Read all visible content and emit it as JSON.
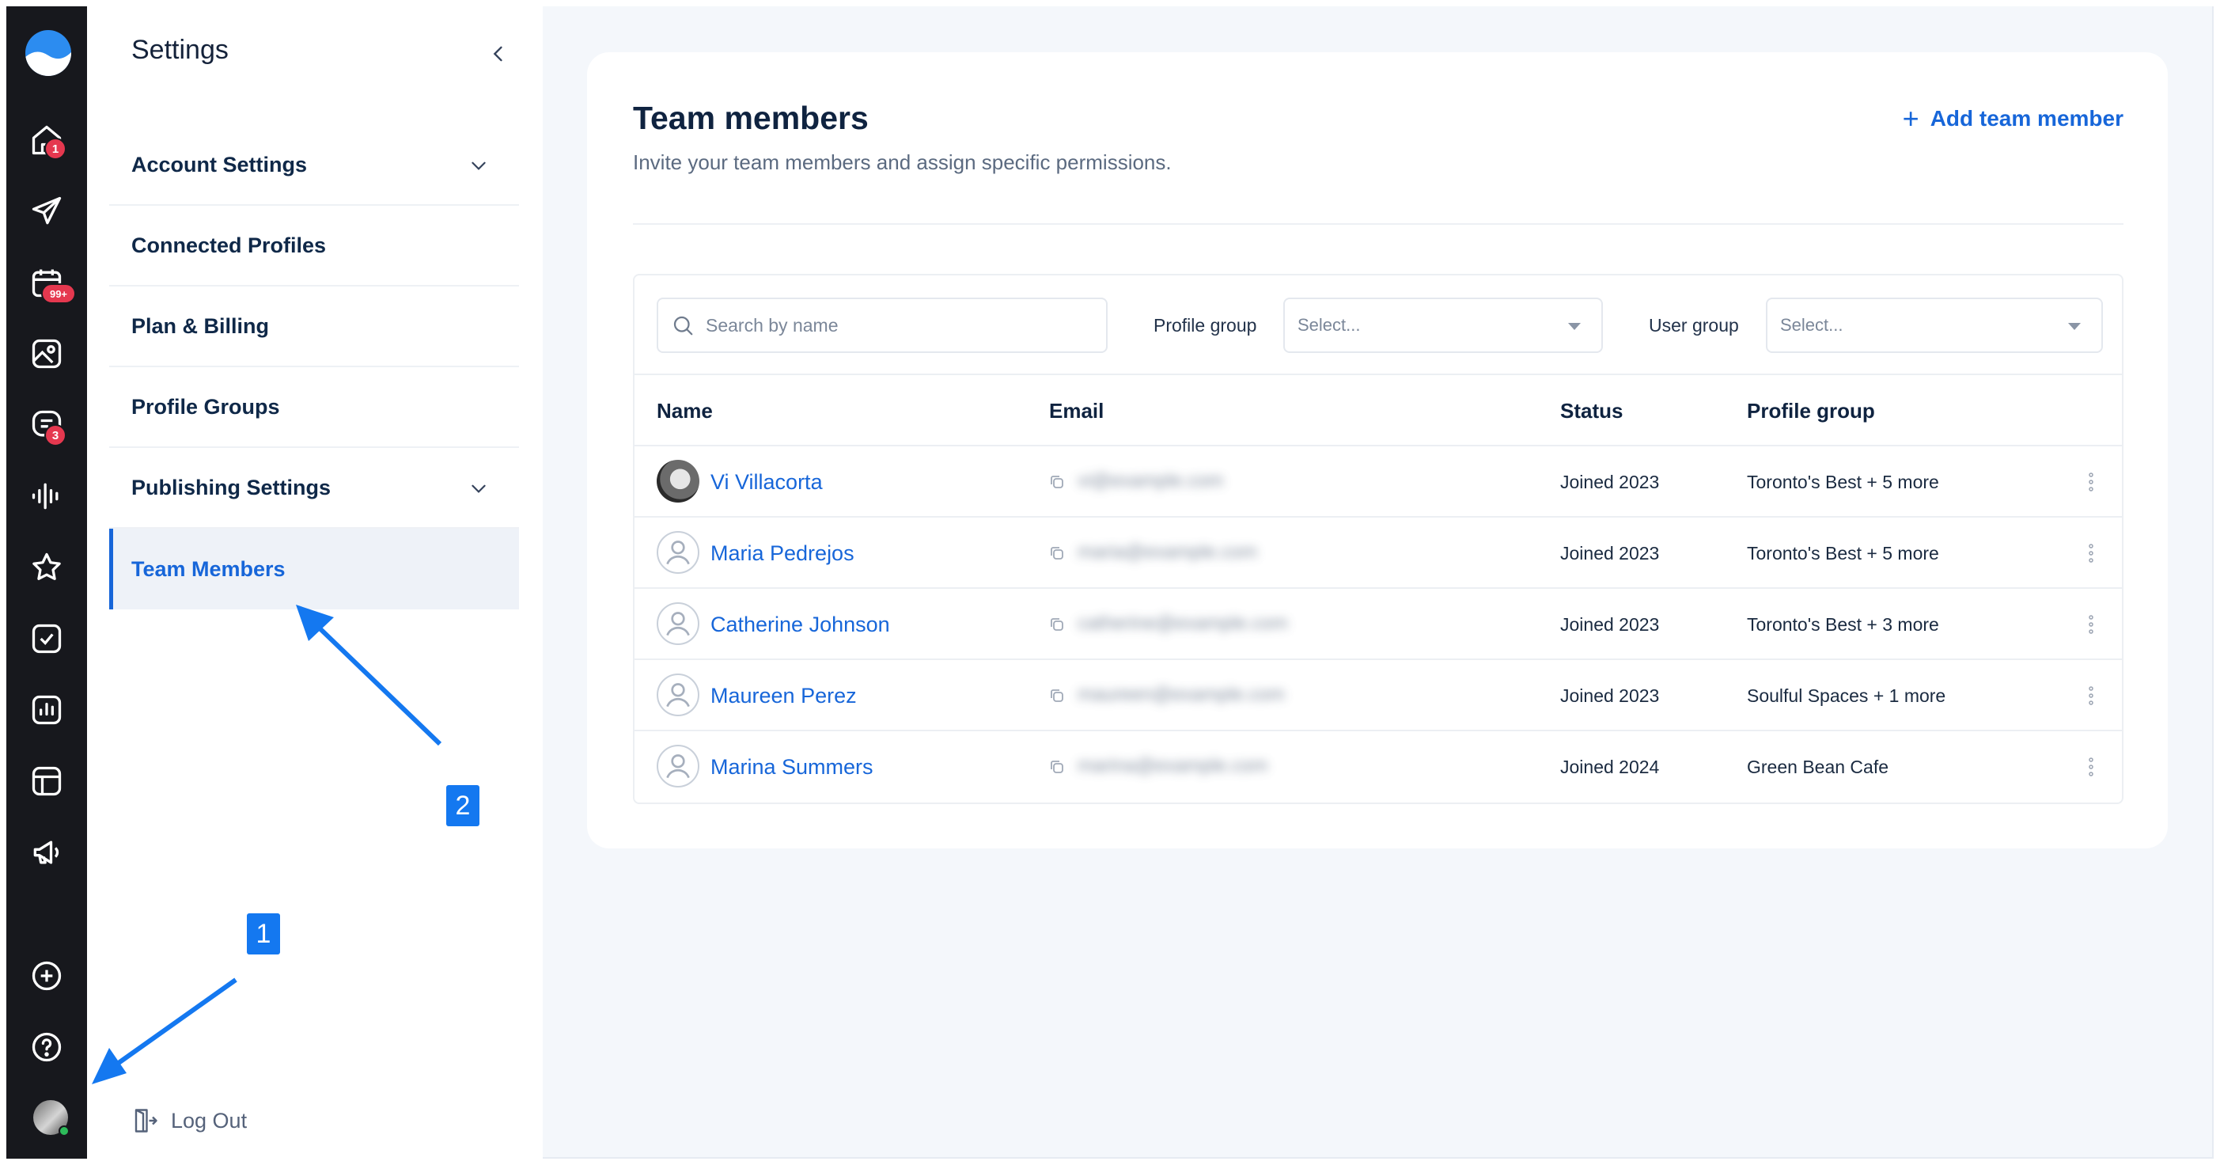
{
  "rail": {
    "badges": {
      "home": "1",
      "calendar": "99+",
      "inbox": "3"
    }
  },
  "settings": {
    "title": "Settings",
    "menu": [
      {
        "label": "Account Settings",
        "has_chevron": true
      },
      {
        "label": "Connected Profiles",
        "has_chevron": false
      },
      {
        "label": "Plan & Billing",
        "has_chevron": false
      },
      {
        "label": "Profile Groups",
        "has_chevron": false
      },
      {
        "label": "Publishing Settings",
        "has_chevron": true
      },
      {
        "label": "Team Members",
        "has_chevron": false,
        "active": true
      }
    ],
    "logout_label": "Log Out"
  },
  "main": {
    "title": "Team members",
    "subtitle": "Invite your team members and assign specific permissions.",
    "add_button": "Add team member",
    "search_placeholder": "Search by name",
    "profile_group_label": "Profile group",
    "profile_group_select": "Select...",
    "user_group_label": "User group",
    "user_group_select": "Select...",
    "columns": [
      "Name",
      "Email",
      "Status",
      "Profile group"
    ],
    "rows": [
      {
        "name": "Vi Villacorta",
        "email": "vi@example.com",
        "status": "Joined 2023",
        "profile_group": "Toronto's Best + 5 more",
        "photo": true
      },
      {
        "name": "Maria Pedrejos",
        "email": "maria@example.com",
        "status": "Joined 2023",
        "profile_group": "Toronto's Best + 5 more",
        "photo": false
      },
      {
        "name": "Catherine Johnson",
        "email": "catherine@example.com",
        "status": "Joined 2023",
        "profile_group": "Toronto's Best + 3 more",
        "photo": false
      },
      {
        "name": "Maureen Perez",
        "email": "maureen@example.com",
        "status": "Joined 2023",
        "profile_group": "Soulful Spaces + 1 more",
        "photo": false
      },
      {
        "name": "Marina Summers",
        "email": "marina@example.com",
        "status": "Joined 2024",
        "profile_group": "Green Bean Cafe",
        "photo": false
      }
    ]
  },
  "annotations": {
    "marker_1": "1",
    "marker_2": "2",
    "color": "#1478f0"
  },
  "colors": {
    "accent": "#1766d9",
    "rail_bg": "#17181d",
    "badge": "#e5384f"
  }
}
